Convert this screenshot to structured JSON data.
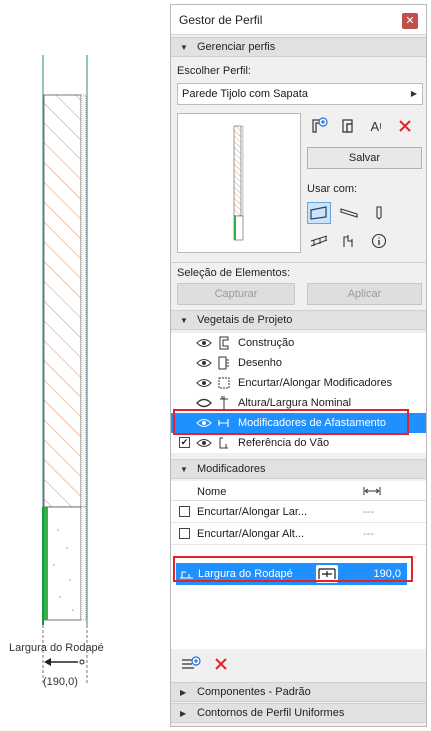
{
  "drawing": {
    "label": "Largura do Rodapé",
    "value": "(190,0)"
  },
  "palette": {
    "title": "Gestor de Perfil",
    "sections": {
      "manage": "Gerenciar perfis",
      "vectors": "Vegetais de Projeto",
      "modifiers": "Modificadores",
      "components": "Componentes - Padrão",
      "contours": "Contornos de Perfil Uniformes"
    },
    "choose_profile_label": "Escolher Perfil:",
    "profile_value": "Parede Tijolo com Sapata",
    "save_label": "Salvar",
    "use_with_label": "Usar com:",
    "element_selection_label": "Seleção de Elementos:",
    "capture_label": "Capturar",
    "apply_label": "Aplicar",
    "tree_items": [
      {
        "label": "Construção",
        "checked": false,
        "selected": false
      },
      {
        "label": "Desenho",
        "checked": false,
        "selected": false
      },
      {
        "label": "Encurtar/Alongar Modificadores",
        "checked": false,
        "selected": false
      },
      {
        "label": "Altura/Largura Nominal",
        "checked": false,
        "selected": false
      },
      {
        "label": "Modificadores de Afastamento",
        "checked": false,
        "selected": true
      },
      {
        "label": "Referência do Vão",
        "checked": true,
        "selected": false
      }
    ],
    "table": {
      "col_name": "Nome",
      "rows": [
        {
          "name": "Encurtar/Alongar Lar...",
          "value": "---"
        },
        {
          "name": "Encurtar/Alongar Alt...",
          "value": "---"
        }
      ],
      "selected_row": {
        "name": "Largura do Rodapé",
        "value": "190,0"
      }
    }
  }
}
